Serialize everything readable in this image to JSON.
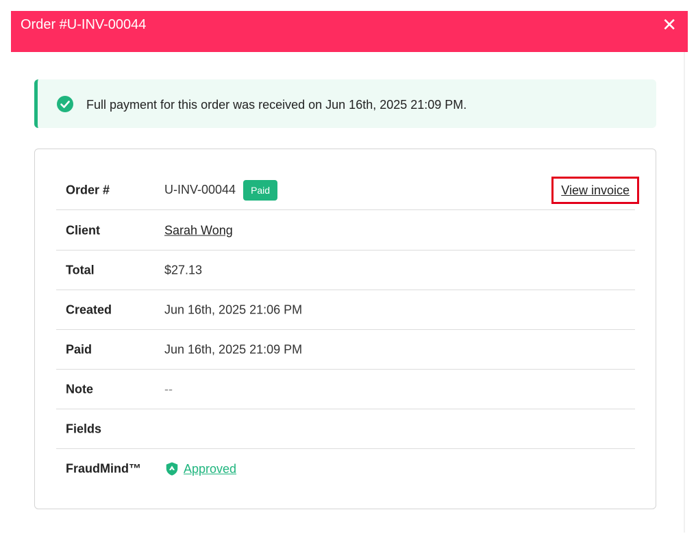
{
  "modal": {
    "title": "Order #U-INV-00044",
    "close_label": "✕"
  },
  "alert": {
    "icon": "check-circle-icon",
    "text": "Full payment for this order was received on Jun 16th, 2025 21:09 PM."
  },
  "details": {
    "order": {
      "label": "Order #",
      "value": "U-INV-00044",
      "badge": "Paid",
      "action": "View invoice"
    },
    "client": {
      "label": "Client",
      "value": "Sarah Wong"
    },
    "total": {
      "label": "Total",
      "value": "$27.13"
    },
    "created": {
      "label": "Created",
      "value": "Jun 16th, 2025 21:06 PM"
    },
    "paid": {
      "label": "Paid",
      "value": "Jun 16th, 2025 21:09 PM"
    },
    "note": {
      "label": "Note",
      "value": "--"
    },
    "fields": {
      "label": "Fields",
      "value": ""
    },
    "fraud": {
      "label": "FraudMind™",
      "icon": "shield-icon",
      "value": "Approved"
    }
  },
  "colors": {
    "header": "#fe2c5f",
    "success": "#1fb57e",
    "highlight": "#e3001b"
  }
}
